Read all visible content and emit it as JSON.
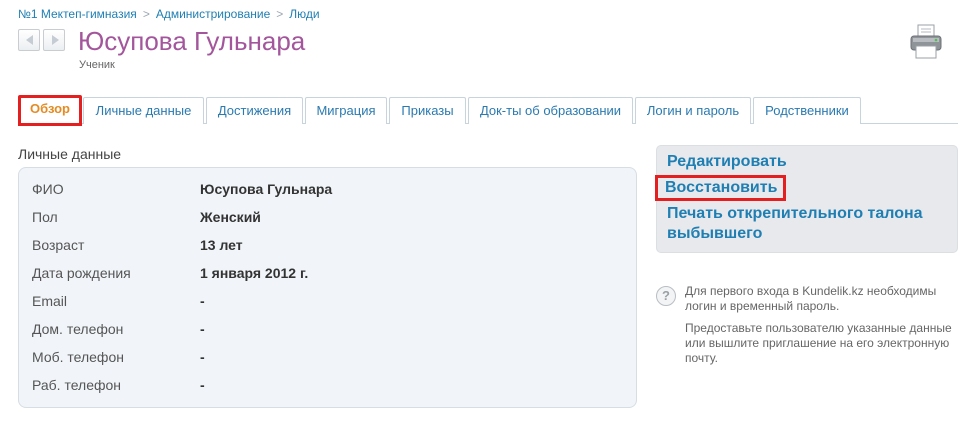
{
  "breadcrumb": {
    "items": [
      "№1 Мектеп-гимназия",
      "Администрирование",
      "Люди"
    ],
    "separator": ">"
  },
  "header": {
    "title": "Юсупова Гульнара",
    "subtitle": "Ученик",
    "icons": [
      "prev-arrow-icon",
      "next-arrow-icon",
      "printer-icon"
    ]
  },
  "tabs": [
    {
      "label": "Обзор",
      "active": true
    },
    {
      "label": "Личные данные"
    },
    {
      "label": "Достижения"
    },
    {
      "label": "Миграция"
    },
    {
      "label": "Приказы"
    },
    {
      "label": "Док-ты об образовании"
    },
    {
      "label": "Логин и пароль"
    },
    {
      "label": "Родственники"
    }
  ],
  "section": {
    "title": "Личные данные"
  },
  "details": [
    {
      "label": "ФИО",
      "value": "Юсупова Гульнара"
    },
    {
      "label": "Пол",
      "value": "Женский"
    },
    {
      "label": "Возраст",
      "value": "13 лет"
    },
    {
      "label": "Дата рождения",
      "value": "1 января 2012 г."
    },
    {
      "label": "Email",
      "value": "-"
    },
    {
      "label": "Дом. телефон",
      "value": "-"
    },
    {
      "label": "Моб. телефон",
      "value": "-"
    },
    {
      "label": "Раб. телефон",
      "value": "-"
    }
  ],
  "actions": {
    "edit": "Редактировать",
    "restore": "Восстановить",
    "print_line1": "Печать открепительного талона",
    "print_line2": "выбывшего"
  },
  "help": {
    "icon": "question-icon",
    "text1": "Для первого входа в Kundelik.kz необходимы логин и временный пароль.",
    "text2": "Предоставьте пользователю указанные данные или вышлите приглашение на его электронную почту."
  },
  "colors": {
    "title": "#a3569b",
    "link": "#1f7fb3",
    "active_tab": "#e48b22",
    "highlight_border": "#e41f1f"
  }
}
